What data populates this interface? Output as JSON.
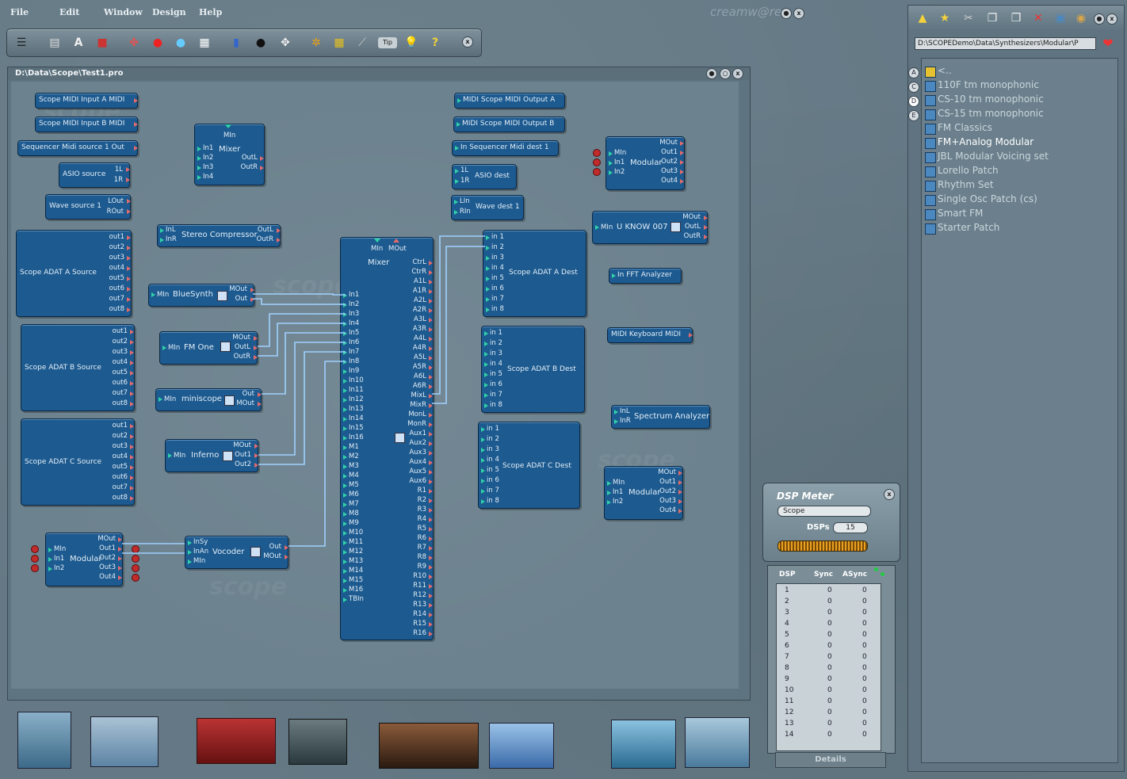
{
  "menu": {
    "file": "File",
    "edit": "Edit",
    "window": "Window",
    "design": "Design",
    "help": "Help",
    "brand": "creamw@re"
  },
  "toolbar": {
    "tip_label": "Tip",
    "help_label": "?",
    "close_label": "x"
  },
  "project": {
    "title": "D:\\Data\\Scope\\Test1.pro"
  },
  "modules": {
    "midiA": {
      "label": "Scope MIDI Input A MIDI"
    },
    "midiB": {
      "label": "Scope MIDI Input B MIDI"
    },
    "seqsrc": {
      "label": "Sequencer Midi source 1 Out"
    },
    "asiosrc": {
      "label": "ASIO source",
      "p1": "1L",
      "p2": "1R"
    },
    "wavesrc": {
      "label": "Wave source 1",
      "p1": "LOut",
      "p2": "ROut"
    },
    "mixer_small": {
      "title": "Mixer",
      "min": "MIn",
      "inputs": [
        "In1",
        "In2",
        "In3",
        "In4"
      ],
      "outL": "OutL",
      "outR": "OutR"
    },
    "adatA_src": {
      "label": "Scope ADAT A Source",
      "outs": [
        "out1",
        "out2",
        "out3",
        "out4",
        "out5",
        "out6",
        "out7",
        "out8"
      ]
    },
    "adatB_src": {
      "label": "Scope ADAT B Source",
      "outs": [
        "out1",
        "out2",
        "out3",
        "out4",
        "out5",
        "out6",
        "out7",
        "out8"
      ]
    },
    "adatC_src": {
      "label": "Scope ADAT C Source",
      "outs": [
        "out1",
        "out2",
        "out3",
        "out4",
        "out5",
        "out6",
        "out7",
        "out8"
      ]
    },
    "compressor": {
      "label": "Stereo Compressor",
      "inL": "InL",
      "inR": "InR",
      "outL": "OutL",
      "outR": "OutR"
    },
    "bluesynth": {
      "label": "BlueSynth",
      "min": "MIn",
      "mout": "MOut",
      "out": "Out"
    },
    "fmone": {
      "label": "FM One",
      "min": "MIn",
      "mout": "MOut",
      "outL": "OutL",
      "outR": "OutR"
    },
    "miniscope": {
      "label": "miniscope",
      "min": "MIn",
      "out": "Out",
      "mout": "MOut"
    },
    "inferno": {
      "label": "Inferno",
      "min": "MIn",
      "mout": "MOut",
      "out1": "Out1",
      "out2": "Out2"
    },
    "modular1": {
      "label": "Modular",
      "min": "MIn",
      "in1": "In1",
      "in2": "In2",
      "outs": [
        "MOut",
        "Out1",
        "Out2",
        "Out3",
        "Out4"
      ]
    },
    "vocoder": {
      "label": "Vocoder",
      "insy": "InSy",
      "inan": "InAn",
      "min": "MIn",
      "out": "Out",
      "mout": "MOut"
    },
    "bigmixer": {
      "title": "Mixer",
      "min": "MIn",
      "mout": "MOut",
      "inputs": [
        "In1",
        "In2",
        "In3",
        "In4",
        "In5",
        "In6",
        "In7",
        "In8",
        "In9",
        "In10",
        "In11",
        "In12",
        "In13",
        "In14",
        "In15",
        "In16",
        "M1",
        "M2",
        "M3",
        "M4",
        "M5",
        "M6",
        "M7",
        "M8",
        "M9",
        "M10",
        "M11",
        "M12",
        "M13",
        "M14",
        "M15",
        "M16",
        "TBIn"
      ],
      "outputs": [
        "CtrL",
        "CtrR",
        "A1L",
        "A1R",
        "A2L",
        "A2R",
        "A3L",
        "A3R",
        "A4L",
        "A4R",
        "A5L",
        "A5R",
        "A6L",
        "A6R",
        "MixL",
        "MixR",
        "MonL",
        "MonR",
        "Aux1",
        "Aux2",
        "Aux3",
        "Aux4",
        "Aux5",
        "Aux6",
        "R1",
        "R2",
        "R3",
        "R4",
        "R5",
        "R6",
        "R7",
        "R8",
        "R9",
        "R10",
        "R11",
        "R12",
        "R13",
        "R14",
        "R15",
        "R16"
      ]
    },
    "midiOutA": {
      "label": "MIDI Scope MIDI Output A"
    },
    "midiOutB": {
      "label": "MIDI Scope MIDI Output B"
    },
    "seqdest": {
      "label": "In Sequencer Midi dest 1"
    },
    "asiodest": {
      "label": "ASIO dest",
      "p1": "1L",
      "p2": "1R"
    },
    "wavedest": {
      "label": "Wave dest 1",
      "p1": "LIn",
      "p2": "RIn"
    },
    "adatA_dest": {
      "label": "Scope ADAT A Dest",
      "ins": [
        "in 1",
        "in 2",
        "in 3",
        "in 4",
        "in 5",
        "in 6",
        "in 7",
        "in 8"
      ]
    },
    "adatB_dest": {
      "label": "Scope ADAT B Dest",
      "ins": [
        "in 1",
        "in 2",
        "in 3",
        "in 4",
        "in 5",
        "in 6",
        "in 7",
        "in 8"
      ]
    },
    "adatC_dest": {
      "label": "Scope ADAT C Dest",
      "ins": [
        "in 1",
        "in 2",
        "in 3",
        "in 4",
        "in 5",
        "in 6",
        "in 7",
        "in 8"
      ]
    },
    "modular2": {
      "label": "Modular",
      "min": "MIn",
      "in1": "In1",
      "in2": "In2",
      "outs": [
        "MOut",
        "Out1",
        "Out2",
        "Out3",
        "Out4"
      ]
    },
    "uknow": {
      "label": "U KNOW 007",
      "min": "MIn",
      "mout": "MOut",
      "outL": "OutL",
      "outR": "OutR"
    },
    "fft": {
      "label": "In FFT Analyzer"
    },
    "midikb": {
      "label": "MIDI Keyboard MIDI"
    },
    "spectrum": {
      "label": "Spectrum Analyzer",
      "inL": "InL",
      "inR": "InR"
    },
    "modular3": {
      "label": "Modular",
      "min": "MIn",
      "in1": "In1",
      "in2": "In2",
      "outs": [
        "MOut",
        "Out1",
        "Out2",
        "Out3",
        "Out4"
      ]
    }
  },
  "browser": {
    "path": "D:\\SCOPEDemo\\Data\\Synthesizers\\Modular\\P",
    "tabs": [
      "A",
      "C",
      "D",
      "E"
    ],
    "items": [
      "<..",
      "110F tm monophonic",
      "CS-10 tm monophonic",
      "CS-15 tm monophonic",
      "FM Classics",
      "FM+Analog Modular",
      "JBL Modular Voicing set",
      "Lorello Patch",
      "Rhythm Set",
      "Single Osc Patch (cs)",
      "Smart FM",
      "Starter Patch"
    ],
    "selected": "FM+Analog Modular"
  },
  "dsp": {
    "title": "DSP Meter",
    "board": "Scope",
    "dsps_label": "DSPs",
    "dsps_value": "15",
    "cols": [
      "DSP",
      "Sync",
      "ASync"
    ],
    "rows": [
      [
        "1",
        "0",
        "0"
      ],
      [
        "2",
        "0",
        "0"
      ],
      [
        "3",
        "0",
        "0"
      ],
      [
        "4",
        "0",
        "0"
      ],
      [
        "5",
        "0",
        "0"
      ],
      [
        "6",
        "0",
        "0"
      ],
      [
        "7",
        "0",
        "0"
      ],
      [
        "8",
        "0",
        "0"
      ],
      [
        "9",
        "0",
        "0"
      ],
      [
        "10",
        "0",
        "0"
      ],
      [
        "11",
        "0",
        "0"
      ],
      [
        "12",
        "0",
        "0"
      ],
      [
        "13",
        "0",
        "0"
      ],
      [
        "14",
        "0",
        "0"
      ]
    ],
    "details": "Details"
  },
  "colors": {
    "module": "#1d5a8f",
    "wire": "#5ba8e8",
    "accent": "#2fd2a8",
    "out_port": "#e36a6a"
  }
}
